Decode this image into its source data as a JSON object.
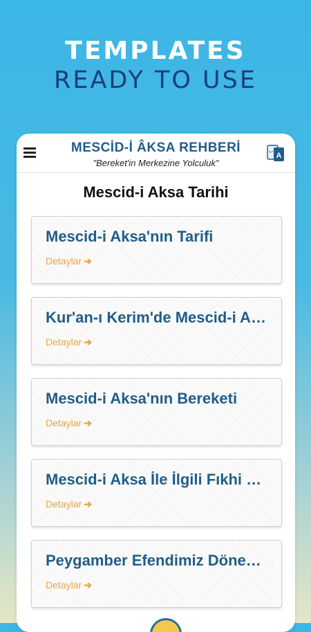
{
  "hero": {
    "title": "TEMPLATES",
    "subtitle": "READY TO USE"
  },
  "appbar": {
    "menu_icon": "hamburger-menu-icon",
    "title": "MESCİD-İ ÂKSA REHBERİ",
    "subtitle": "\"Bereket'in Merkezine Yolculuk\"",
    "lang_icon": "translate-icon"
  },
  "page": {
    "title": "Mescid-i Aksa Tarihi"
  },
  "cards": [
    {
      "title": "Mescid-i Aksa'nın Tarifi",
      "link": "Detaylar"
    },
    {
      "title": "Kur'an-ı Kerim'de Mescid-i Aksa",
      "link": "Detaylar"
    },
    {
      "title": "Mescid-i Aksa'nın Bereketi",
      "link": "Detaylar"
    },
    {
      "title": "Mescid-i Aksa İle İlgili Fıkhi Hükümler",
      "link": "Detaylar"
    },
    {
      "title": "Peygamber Efendimiz Döneminde Mescid-i Aksa",
      "link": "Detaylar"
    }
  ],
  "colors": {
    "primary": "#1f5d8a",
    "accent": "#e8a53c",
    "hero_subtitle": "#1d3e78"
  }
}
